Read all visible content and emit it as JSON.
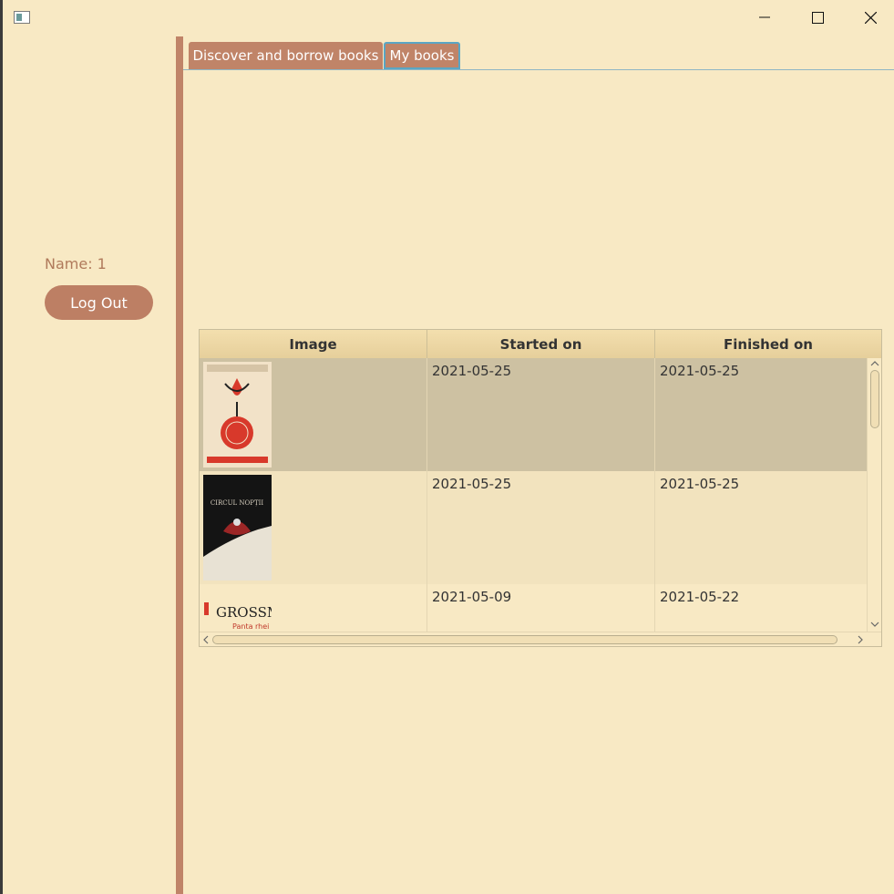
{
  "window": {
    "controls": {
      "minimize_icon": "minimize-icon",
      "maximize_icon": "maximize-icon",
      "close_icon": "close-icon"
    }
  },
  "sidebar": {
    "name_label": "Name: 1",
    "logout_label": "Log Out"
  },
  "tabs": [
    {
      "label": "Discover and borrow books",
      "selected": false
    },
    {
      "label": "My books",
      "selected": true
    }
  ],
  "table": {
    "columns": [
      "Image",
      "Started on",
      "Finished on"
    ],
    "rows": [
      {
        "cover_icon": "book-cover-image",
        "cover_text": "",
        "started": "2021-05-25",
        "finished": "2021-05-25"
      },
      {
        "cover_icon": "book-cover-image",
        "cover_text": "CIRCUL NOPȚII",
        "started": "2021-05-25",
        "finished": "2021-05-25"
      },
      {
        "cover_icon": "book-cover-image",
        "cover_text": "GROSSMAN",
        "cover_subtext": "Panta rhei",
        "started": "2021-05-09",
        "finished": "2021-05-22"
      }
    ]
  },
  "colors": {
    "background": "#f8e9c4",
    "accent": "#c08468",
    "selected_row": "#cdc1a2",
    "tab_focus_border": "#5aa6c4"
  }
}
